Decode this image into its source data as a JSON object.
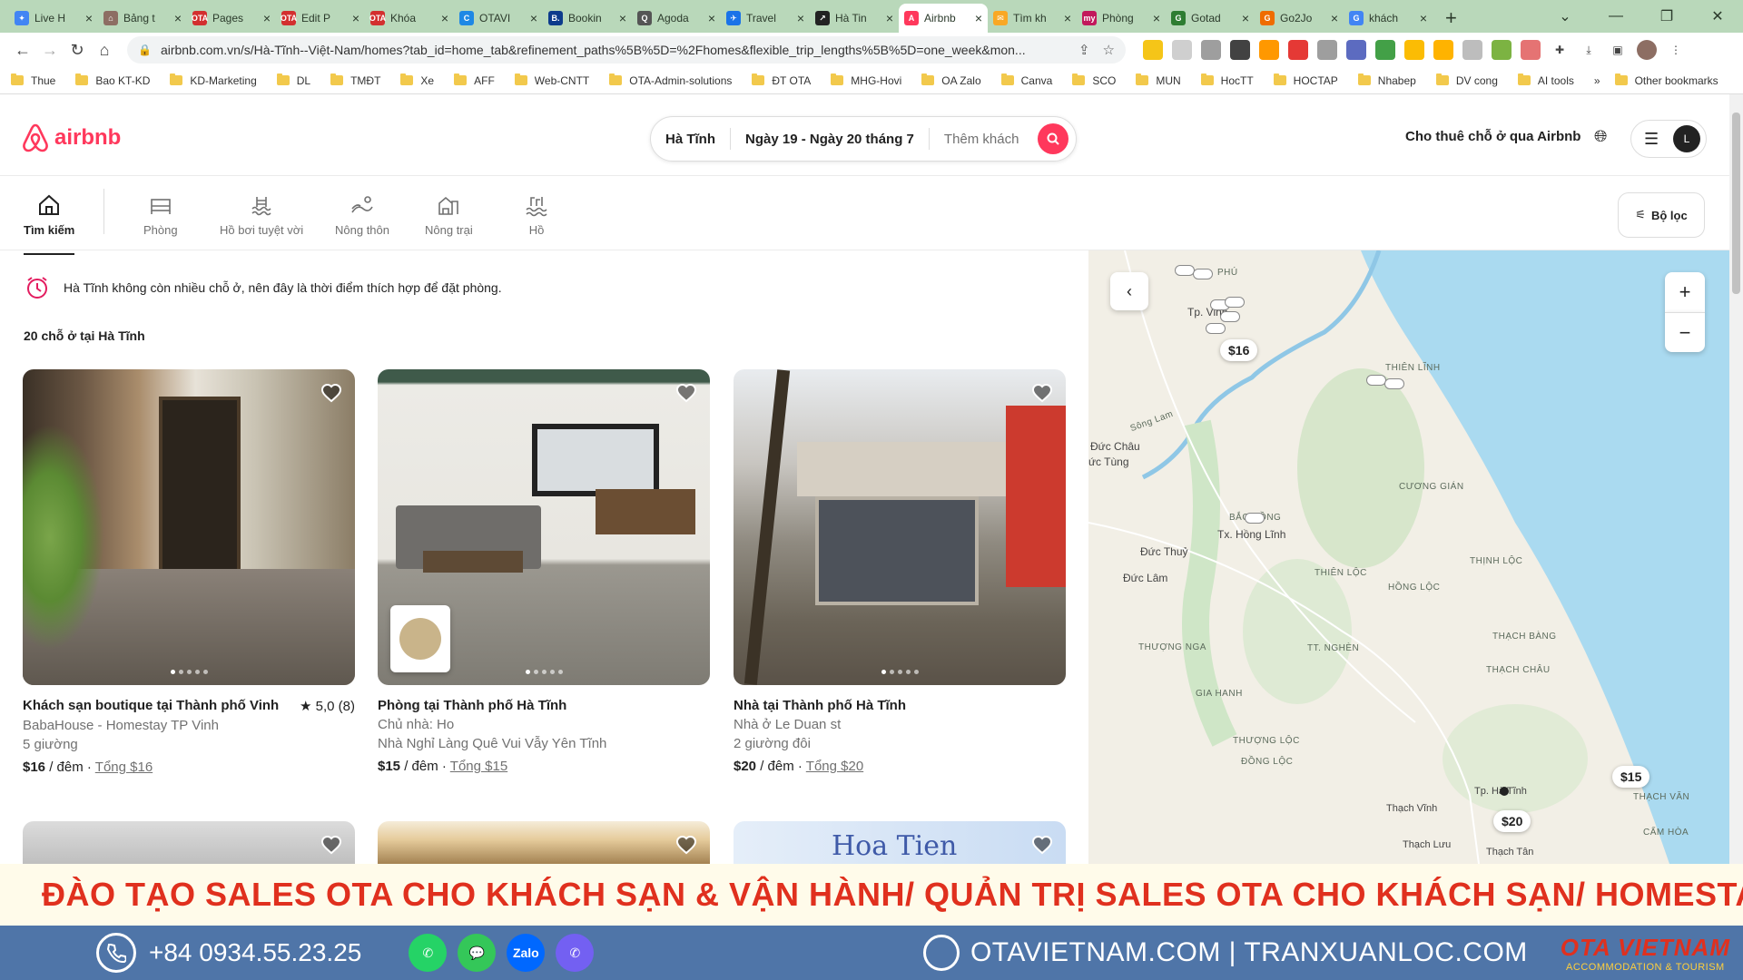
{
  "browser": {
    "tabs": [
      {
        "title": "Live H",
        "color": "#4285f4",
        "glyph": "✦"
      },
      {
        "title": "Bảng t",
        "color": "#8d6e63",
        "glyph": "⌂"
      },
      {
        "title": "Pages",
        "color": "#d32f2f",
        "glyph": "OTA"
      },
      {
        "title": "Edit P",
        "color": "#d32f2f",
        "glyph": "OTA"
      },
      {
        "title": "Khóa",
        "color": "#d32f2f",
        "glyph": "OTA"
      },
      {
        "title": "OTAVI",
        "color": "#1e88e5",
        "glyph": "C"
      },
      {
        "title": "Bookin",
        "color": "#0d3b8c",
        "glyph": "B."
      },
      {
        "title": "Agoda",
        "color": "#555555",
        "glyph": "Q"
      },
      {
        "title": "Travel",
        "color": "#1a73e8",
        "glyph": "✈"
      },
      {
        "title": "Hà Tin",
        "color": "#222222",
        "glyph": "↗"
      },
      {
        "title": "Airbnb",
        "color": "#ff385c",
        "glyph": "A"
      },
      {
        "title": "Tìm kh",
        "color": "#f9a825",
        "glyph": "✉"
      },
      {
        "title": "Phòng",
        "color": "#c2185b",
        "glyph": "my"
      },
      {
        "title": "Gotad",
        "color": "#2e7d32",
        "glyph": "G"
      },
      {
        "title": "Go2Jo",
        "color": "#ef6c00",
        "glyph": "G"
      },
      {
        "title": "khách",
        "color": "#4285f4",
        "glyph": "G"
      }
    ],
    "active_tab_index": 10,
    "new_tab": "+",
    "window_controls": [
      "⌄",
      "—",
      "❐",
      "✕"
    ],
    "url": "airbnb.com.vn/s/Hà-Tĩnh--Việt-Nam/homes?tab_id=home_tab&refinement_paths%5B%5D=%2Fhomes&flexible_trip_lengths%5B%5D=one_week&mon...",
    "bookmarks": [
      "Thue",
      "Bao KT-KD",
      "KD-Marketing",
      "DL",
      "TMĐT",
      "Xe",
      "AFF",
      "Web-CNTT",
      "OTA-Admin-solutions",
      "ĐT OTA",
      "MHG-Hovi",
      "OA Zalo",
      "Canva",
      "SCO",
      "MUN",
      "HocTT",
      "HOCTAP",
      "Nhabep",
      "DV cong",
      "AI tools"
    ],
    "bookmarks_more": "»",
    "other_bookmarks": "Other bookmarks"
  },
  "header": {
    "logo_text": "airbnb",
    "search": {
      "location": "Hà Tĩnh",
      "dates": "Ngày 19 - Ngày 20 tháng 7",
      "guests": "Thêm khách"
    },
    "host_link": "Cho thuê chỗ ở qua Airbnb",
    "user_initial": "L"
  },
  "categories": [
    {
      "label": "Tìm kiếm",
      "icon": "house-icon",
      "active": true
    },
    {
      "label": "Phòng",
      "icon": "bed-icon",
      "active": false
    },
    {
      "label": "Hồ bơi tuyệt vời",
      "icon": "pool-icon",
      "active": false
    },
    {
      "label": "Nông thôn",
      "icon": "countryside-icon",
      "active": false
    },
    {
      "label": "Nông trại",
      "icon": "farm-icon",
      "active": false
    },
    {
      "label": "Hồ",
      "icon": "lake-icon",
      "active": false
    }
  ],
  "filter_label": "Bộ lọc",
  "notice": "Hà Tĩnh không còn nhiều chỗ ở, nên đây là thời điểm thích hợp để đặt phòng.",
  "results_count": "20 chỗ ở tại Hà Tĩnh",
  "listings": [
    {
      "title": "Khách sạn boutique tại Thành phố Vinh",
      "rating": "★ 5,0 (8)",
      "line1": "BabaHouse - Homestay TP Vinh",
      "line2": "5 giường",
      "price": "$16",
      "per": " / đêm · ",
      "total": "Tổng $16"
    },
    {
      "title": "Phòng tại Thành phố Hà Tĩnh",
      "rating": "",
      "line1": "Chủ nhà: Ho",
      "line2": "Nhà Nghỉ Làng Quê Vui Vẫy Yên Tĩnh",
      "price": "$15",
      "per": " / đêm · ",
      "total": "Tổng $15"
    },
    {
      "title": "Nhà tại Thành phố Hà Tĩnh",
      "rating": "",
      "line1": "Nhà ở Le Duan st",
      "line2": "2 giường đôi",
      "price": "$20",
      "per": " / đêm · ",
      "total": "Tổng $20"
    }
  ],
  "next_card_text": "Hoa Tien",
  "map": {
    "zoom_in": "+",
    "zoom_out": "−",
    "pins": [
      "$16",
      "$15",
      "$20"
    ],
    "labels": {
      "phu": "PHÚ",
      "tp_vinh": "Tp. Vinh",
      "thien_linh": "THIÊN LĨNH",
      "duc_chau": "Đức Châu",
      "duc_tung": "ức Tùng",
      "cuong_gian": "CƯƠNG GIÁN",
      "bac_hong": "BẮC HỒNG",
      "hong_linh": "Tx. Hồng Lĩnh",
      "duc_thuy": "Đức Thuỷ",
      "thien_loc": "THIÊN LỘC",
      "thinh_loc": "THỊNH LỘC",
      "duc_lam": "Đức Lâm",
      "hong_loc": "HỒNG LỘC",
      "thuong_nga": "THƯỢNG NGA",
      "tt_nghen": "TT. NGHÈN",
      "thach_bang": "THẠCH BÀNG",
      "thach_chau": "THẠCH CHÂU",
      "gia_hanh": "GIA HANH",
      "thuong_loc": "THƯỢNG LỘC",
      "dong_loc": "ĐỒNG LỘC",
      "tp_ha_tinh": "Tp. Hà Tĩnh",
      "thach_van": "THẠCH VĂN",
      "thach_vinh": "Thạch Vĩnh",
      "cam_hoa": "CẨM HÒA",
      "thach_luu": "Thạch Lưu",
      "thach_tan": "Thạch Tân",
      "song_lam": "Sông Lam"
    }
  },
  "promo": {
    "headline": "ĐÀO TẠO SALES OTA CHO KHÁCH SẠN & VẬN HÀNH/ QUẢN TRỊ SALES OTA CHO KHÁCH SẠN/ HOMESTAY",
    "phone": "+84 0934.55.23.25",
    "socials": [
      {
        "name": "whatsapp",
        "glyph": "✆",
        "color": "#25d366"
      },
      {
        "name": "messages",
        "glyph": "💬",
        "color": "#34c759"
      },
      {
        "name": "zalo",
        "glyph": "Zalo",
        "color": "#0068ff"
      },
      {
        "name": "viber",
        "glyph": "✆",
        "color": "#7360f2"
      }
    ],
    "website": "OTAVIETNAM.COM | TRANXUANLOC.COM",
    "brand_main": "OTA VIETNAM",
    "brand_sub": "ACCOMMODATION & TOURISM"
  }
}
